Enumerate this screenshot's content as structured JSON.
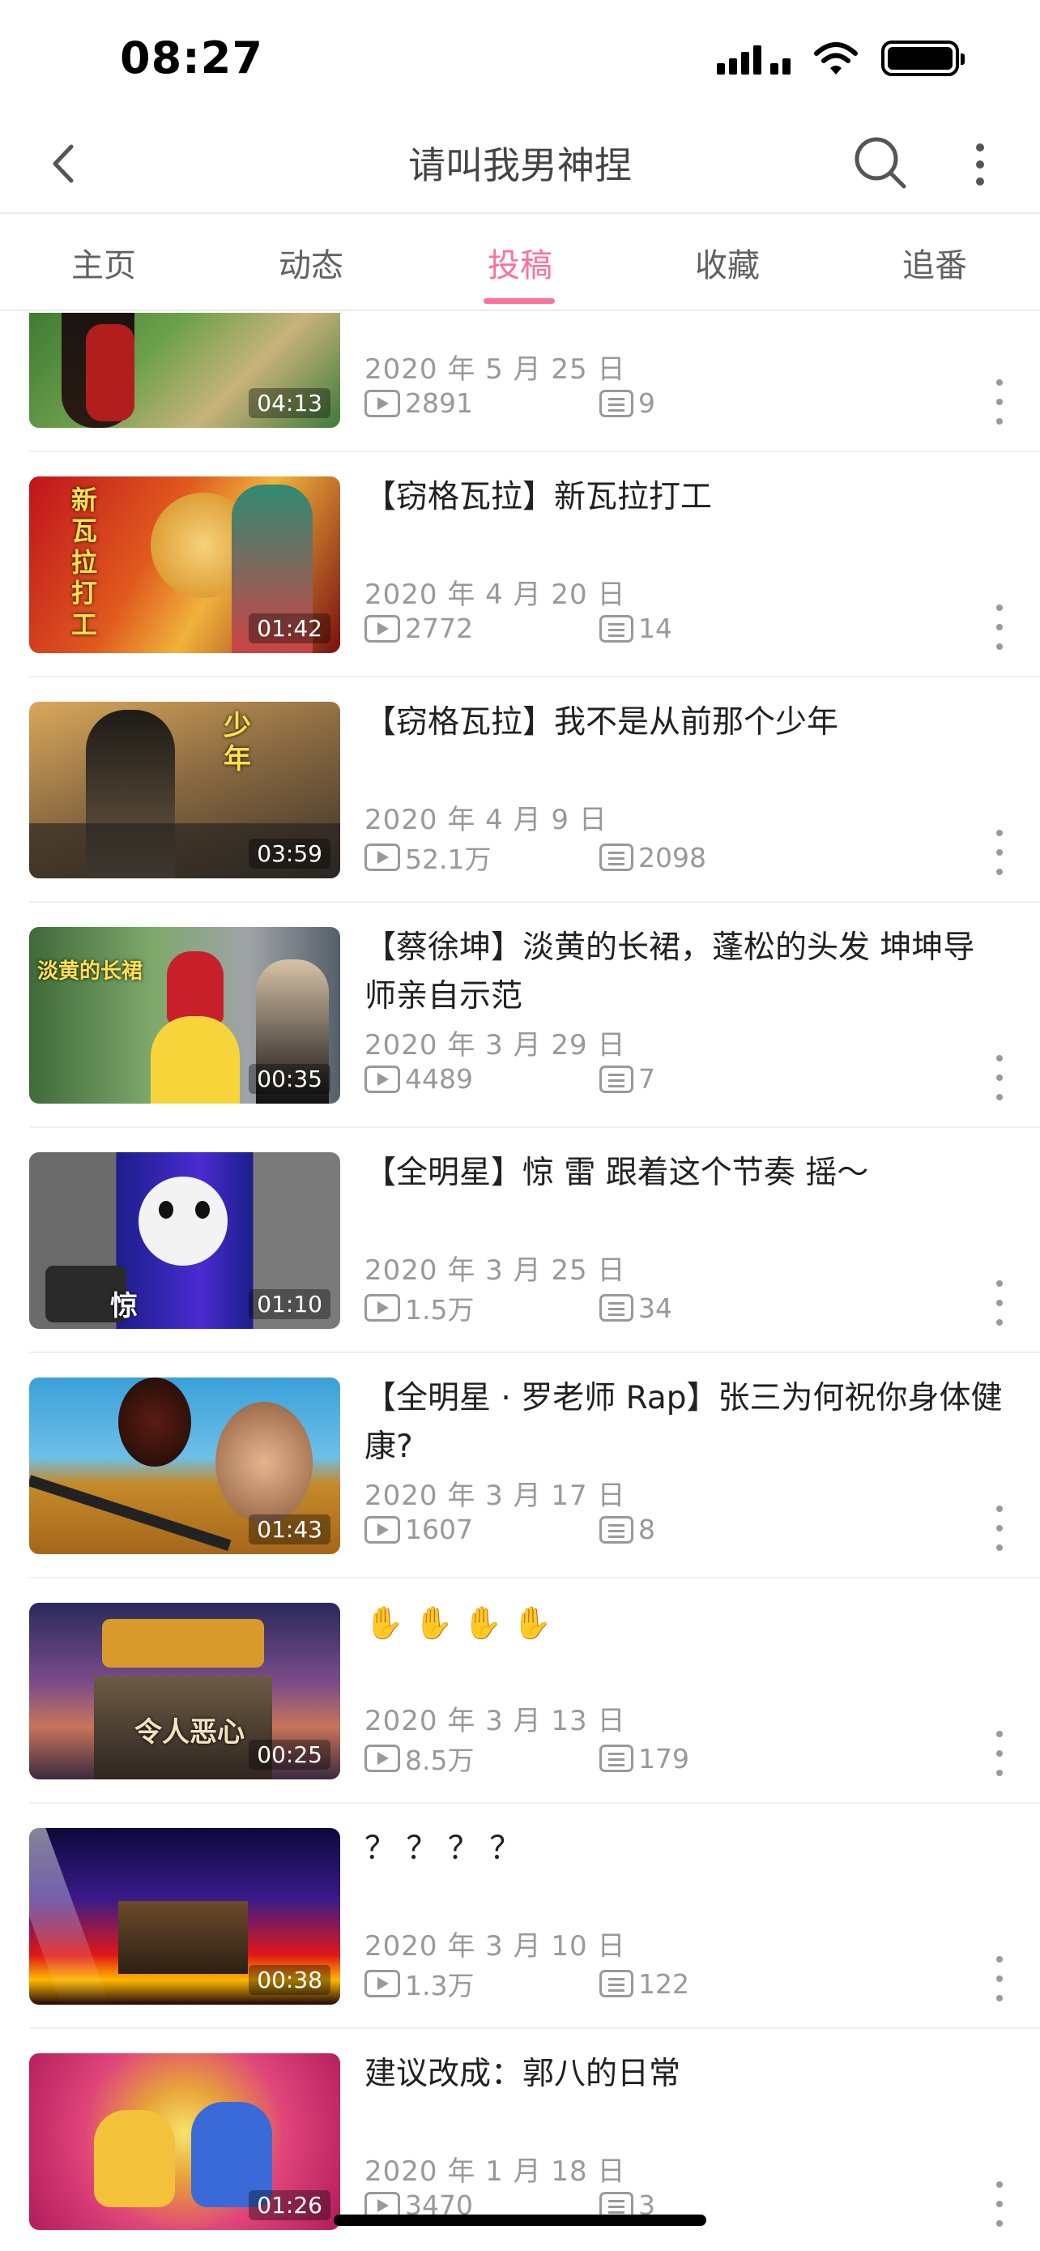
{
  "status_bar": {
    "time": "08:27"
  },
  "nav": {
    "title": "请叫我男神捏"
  },
  "tabs": [
    "主页",
    "动态",
    "投稿",
    "收藏",
    "追番"
  ],
  "active_tab": "投稿",
  "colors": {
    "accent": "#fb7299",
    "text": "#212121",
    "meta": "#999999"
  },
  "videos": [
    {
      "title": "",
      "duration": "04:13",
      "date": "2020 年 5 月 25 日",
      "plays": "2891",
      "comments": "9",
      "thumb_text": ""
    },
    {
      "title": "【窃格瓦拉】新瓦拉打工",
      "duration": "01:42",
      "date": "2020 年 4 月 20 日",
      "plays": "2772",
      "comments": "14",
      "thumb_text": "新瓦拉打工"
    },
    {
      "title": "【窃格瓦拉】我不是从前那个少年",
      "duration": "03:59",
      "date": "2020 年 4 月 9 日",
      "plays": "52.1万",
      "comments": "2098",
      "thumb_text": "少年"
    },
    {
      "title": "【蔡徐坤】淡黄的长裙，蓬松的头发 坤坤导师亲自示范",
      "duration": "00:35",
      "date": "2020 年 3 月 29 日",
      "plays": "4489",
      "comments": "7",
      "thumb_text": "淡黄的长裙"
    },
    {
      "title": "【全明星】惊 雷 跟着这个节奏 摇～",
      "duration": "01:10",
      "date": "2020 年 3 月 25 日",
      "plays": "1.5万",
      "comments": "34",
      "thumb_text": "惊"
    },
    {
      "title": "【全明星 · 罗老师 Rap】张三为何祝你身体健康?",
      "duration": "01:43",
      "date": "2020 年 3 月 17 日",
      "plays": "1607",
      "comments": "8",
      "thumb_text": ""
    },
    {
      "title": "✋ ✋ ✋ ✋",
      "duration": "00:25",
      "date": "2020 年 3 月 13 日",
      "plays": "8.5万",
      "comments": "179",
      "thumb_text": "令人恶心"
    },
    {
      "title": "？ ？ ？ ？",
      "duration": "00:38",
      "date": "2020 年 3 月 10 日",
      "plays": "1.3万",
      "comments": "122",
      "thumb_text": ""
    },
    {
      "title": "建议改成：郭八的日常",
      "duration": "01:26",
      "date": "2020 年 1 月 18 日",
      "plays": "3470",
      "comments": "3",
      "thumb_text": ""
    }
  ]
}
